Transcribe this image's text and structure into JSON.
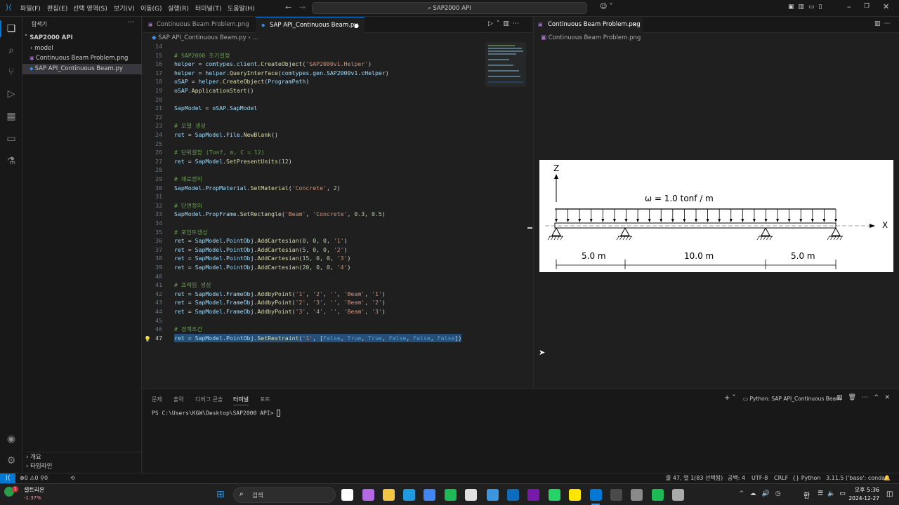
{
  "window": {
    "menu": [
      "파일(F)",
      "편집(E)",
      "선택 영역(S)",
      "보기(V)",
      "이동(G)",
      "실행(R)",
      "터미널(T)",
      "도움말(H)"
    ],
    "search": "SAP2000 API"
  },
  "sidebar": {
    "title": "탐색기",
    "root": "SAP2000 API",
    "items": [
      "model",
      "Continuous Beam Problem.png",
      "SAP API_Continuous Beam.py"
    ],
    "bottom": [
      "개요",
      "타임라인"
    ]
  },
  "editor": {
    "tabs": [
      "Continuous Beam Problem.png",
      "SAP API_Continuous Beam.py"
    ],
    "breadcrumb": [
      "SAP API_Continuous Beam.py",
      "..."
    ],
    "lines": [
      {
        "n": "14",
        "segs": []
      },
      {
        "n": "15",
        "segs": [
          [
            "cm",
            "# SAP2000 초기설정"
          ]
        ]
      },
      {
        "n": "16",
        "segs": [
          [
            "var",
            "helper"
          ],
          [
            "op",
            " = "
          ],
          [
            "var",
            "comtypes"
          ],
          [
            "op",
            "."
          ],
          [
            "var",
            "client"
          ],
          [
            "op",
            "."
          ],
          [
            "fn",
            "CreateObject"
          ],
          [
            "op",
            "("
          ],
          [
            "str",
            "'SAP2000v1.Helper'"
          ],
          [
            "op",
            ")"
          ]
        ]
      },
      {
        "n": "17",
        "segs": [
          [
            "var",
            "helper"
          ],
          [
            "op",
            " = "
          ],
          [
            "var",
            "helper"
          ],
          [
            "op",
            "."
          ],
          [
            "fn",
            "QueryInterface"
          ],
          [
            "op",
            "("
          ],
          [
            "var",
            "comtypes"
          ],
          [
            "op",
            "."
          ],
          [
            "var",
            "gen"
          ],
          [
            "op",
            "."
          ],
          [
            "var",
            "SAP2000v1"
          ],
          [
            "op",
            "."
          ],
          [
            "var",
            "cHelper"
          ],
          [
            "op",
            ")"
          ]
        ]
      },
      {
        "n": "18",
        "segs": [
          [
            "var",
            "oSAP"
          ],
          [
            "op",
            " = "
          ],
          [
            "var",
            "helper"
          ],
          [
            "op",
            "."
          ],
          [
            "fn",
            "CreateObject"
          ],
          [
            "op",
            "("
          ],
          [
            "var",
            "ProgramPath"
          ],
          [
            "op",
            ")"
          ]
        ]
      },
      {
        "n": "19",
        "segs": [
          [
            "var",
            "oSAP"
          ],
          [
            "op",
            "."
          ],
          [
            "fn",
            "ApplicationStart"
          ],
          [
            "op",
            "()"
          ]
        ]
      },
      {
        "n": "20",
        "segs": []
      },
      {
        "n": "21",
        "segs": [
          [
            "var",
            "SapModel"
          ],
          [
            "op",
            " = "
          ],
          [
            "var",
            "oSAP"
          ],
          [
            "op",
            "."
          ],
          [
            "var",
            "SapModel"
          ]
        ]
      },
      {
        "n": "22",
        "segs": []
      },
      {
        "n": "23",
        "segs": [
          [
            "cm",
            "# 모델 생성"
          ]
        ]
      },
      {
        "n": "24",
        "segs": [
          [
            "var",
            "ret"
          ],
          [
            "op",
            " = "
          ],
          [
            "var",
            "SapModel"
          ],
          [
            "op",
            "."
          ],
          [
            "var",
            "File"
          ],
          [
            "op",
            "."
          ],
          [
            "fn",
            "NewBlank"
          ],
          [
            "op",
            "()"
          ]
        ]
      },
      {
        "n": "25",
        "segs": []
      },
      {
        "n": "26",
        "segs": [
          [
            "cm",
            "# 단위설정 (Tonf, m, C = 12)"
          ]
        ]
      },
      {
        "n": "27",
        "segs": [
          [
            "var",
            "ret"
          ],
          [
            "op",
            " = "
          ],
          [
            "var",
            "SapModel"
          ],
          [
            "op",
            "."
          ],
          [
            "fn",
            "SetPresentUnits"
          ],
          [
            "op",
            "("
          ],
          [
            "num",
            "12"
          ],
          [
            "op",
            ")"
          ]
        ]
      },
      {
        "n": "28",
        "segs": []
      },
      {
        "n": "29",
        "segs": [
          [
            "cm",
            "# 재료정의"
          ]
        ]
      },
      {
        "n": "30",
        "segs": [
          [
            "var",
            "SapModel"
          ],
          [
            "op",
            "."
          ],
          [
            "var",
            "PropMaterial"
          ],
          [
            "op",
            "."
          ],
          [
            "fn",
            "SetMaterial"
          ],
          [
            "op",
            "("
          ],
          [
            "str",
            "'Concrete'"
          ],
          [
            "op",
            ", "
          ],
          [
            "num",
            "2"
          ],
          [
            "op",
            ")"
          ]
        ]
      },
      {
        "n": "31",
        "segs": []
      },
      {
        "n": "32",
        "segs": [
          [
            "cm",
            "# 단면정의"
          ]
        ]
      },
      {
        "n": "33",
        "segs": [
          [
            "var",
            "SapModel"
          ],
          [
            "op",
            "."
          ],
          [
            "var",
            "PropFrame"
          ],
          [
            "op",
            "."
          ],
          [
            "fn",
            "SetRectangle"
          ],
          [
            "op",
            "("
          ],
          [
            "str",
            "'Beam'"
          ],
          [
            "op",
            ", "
          ],
          [
            "str",
            "'Concrete'"
          ],
          [
            "op",
            ", "
          ],
          [
            "num",
            "0.3"
          ],
          [
            "op",
            ", "
          ],
          [
            "num",
            "0.5"
          ],
          [
            "op",
            ")"
          ]
        ]
      },
      {
        "n": "34",
        "segs": []
      },
      {
        "n": "35",
        "segs": [
          [
            "cm",
            "# 포인트생성"
          ]
        ]
      },
      {
        "n": "36",
        "segs": [
          [
            "var",
            "ret"
          ],
          [
            "op",
            " = "
          ],
          [
            "var",
            "SapModel"
          ],
          [
            "op",
            "."
          ],
          [
            "var",
            "PointObj"
          ],
          [
            "op",
            "."
          ],
          [
            "fn",
            "AddCartesian"
          ],
          [
            "op",
            "("
          ],
          [
            "num",
            "0"
          ],
          [
            "op",
            ", "
          ],
          [
            "num",
            "0"
          ],
          [
            "op",
            ", "
          ],
          [
            "num",
            "0"
          ],
          [
            "op",
            ", "
          ],
          [
            "str",
            "'1'"
          ],
          [
            "op",
            ")"
          ]
        ]
      },
      {
        "n": "37",
        "segs": [
          [
            "var",
            "ret"
          ],
          [
            "op",
            " = "
          ],
          [
            "var",
            "SapModel"
          ],
          [
            "op",
            "."
          ],
          [
            "var",
            "PointObj"
          ],
          [
            "op",
            "."
          ],
          [
            "fn",
            "AddCartesian"
          ],
          [
            "op",
            "("
          ],
          [
            "num",
            "5"
          ],
          [
            "op",
            ", "
          ],
          [
            "num",
            "0"
          ],
          [
            "op",
            ", "
          ],
          [
            "num",
            "0"
          ],
          [
            "op",
            ", "
          ],
          [
            "str",
            "'2'"
          ],
          [
            "op",
            ")"
          ]
        ]
      },
      {
        "n": "38",
        "segs": [
          [
            "var",
            "ret"
          ],
          [
            "op",
            " = "
          ],
          [
            "var",
            "SapModel"
          ],
          [
            "op",
            "."
          ],
          [
            "var",
            "PointObj"
          ],
          [
            "op",
            "."
          ],
          [
            "fn",
            "AddCartesian"
          ],
          [
            "op",
            "("
          ],
          [
            "num",
            "15"
          ],
          [
            "op",
            ", "
          ],
          [
            "num",
            "0"
          ],
          [
            "op",
            ", "
          ],
          [
            "num",
            "0"
          ],
          [
            "op",
            ", "
          ],
          [
            "str",
            "'3'"
          ],
          [
            "op",
            ")"
          ]
        ]
      },
      {
        "n": "39",
        "segs": [
          [
            "var",
            "ret"
          ],
          [
            "op",
            " = "
          ],
          [
            "var",
            "SapModel"
          ],
          [
            "op",
            "."
          ],
          [
            "var",
            "PointObj"
          ],
          [
            "op",
            "."
          ],
          [
            "fn",
            "AddCartesian"
          ],
          [
            "op",
            "("
          ],
          [
            "num",
            "20"
          ],
          [
            "op",
            ", "
          ],
          [
            "num",
            "0"
          ],
          [
            "op",
            ", "
          ],
          [
            "num",
            "0"
          ],
          [
            "op",
            ", "
          ],
          [
            "str",
            "'4'"
          ],
          [
            "op",
            ")"
          ]
        ]
      },
      {
        "n": "40",
        "segs": []
      },
      {
        "n": "41",
        "segs": [
          [
            "cm",
            "# 프레임 생성"
          ]
        ]
      },
      {
        "n": "42",
        "segs": [
          [
            "var",
            "ret"
          ],
          [
            "op",
            " = "
          ],
          [
            "var",
            "SapModel"
          ],
          [
            "op",
            "."
          ],
          [
            "var",
            "FrameObj"
          ],
          [
            "op",
            "."
          ],
          [
            "fn",
            "AddbyPoint"
          ],
          [
            "op",
            "("
          ],
          [
            "str",
            "'1'"
          ],
          [
            "op",
            ", "
          ],
          [
            "str",
            "'2'"
          ],
          [
            "op",
            ", "
          ],
          [
            "str",
            "''"
          ],
          [
            "op",
            ", "
          ],
          [
            "str",
            "'Beam'"
          ],
          [
            "op",
            ", "
          ],
          [
            "str",
            "'1'"
          ],
          [
            "op",
            ")"
          ]
        ]
      },
      {
        "n": "43",
        "segs": [
          [
            "var",
            "ret"
          ],
          [
            "op",
            " = "
          ],
          [
            "var",
            "SapModel"
          ],
          [
            "op",
            "."
          ],
          [
            "var",
            "FrameObj"
          ],
          [
            "op",
            "."
          ],
          [
            "fn",
            "AddbyPoint"
          ],
          [
            "op",
            "("
          ],
          [
            "str",
            "'2'"
          ],
          [
            "op",
            ", "
          ],
          [
            "str",
            "'3'"
          ],
          [
            "op",
            ", "
          ],
          [
            "str",
            "''"
          ],
          [
            "op",
            ", "
          ],
          [
            "str",
            "'Beam'"
          ],
          [
            "op",
            ", "
          ],
          [
            "str",
            "'2'"
          ],
          [
            "op",
            ")"
          ]
        ]
      },
      {
        "n": "44",
        "segs": [
          [
            "var",
            "ret"
          ],
          [
            "op",
            " = "
          ],
          [
            "var",
            "SapModel"
          ],
          [
            "op",
            "."
          ],
          [
            "var",
            "FrameObj"
          ],
          [
            "op",
            "."
          ],
          [
            "fn",
            "AddbyPoint"
          ],
          [
            "op",
            "("
          ],
          [
            "str",
            "'3'"
          ],
          [
            "op",
            ", "
          ],
          [
            "str",
            "'4'"
          ],
          [
            "op",
            ", "
          ],
          [
            "str",
            "''"
          ],
          [
            "op",
            ", "
          ],
          [
            "str",
            "'Beam'"
          ],
          [
            "op",
            ", "
          ],
          [
            "str",
            "'3'"
          ],
          [
            "op",
            ")"
          ]
        ]
      },
      {
        "n": "45",
        "segs": []
      },
      {
        "n": "46",
        "segs": [
          [
            "cm",
            "# 경계조건"
          ]
        ]
      },
      {
        "n": "47",
        "segs": [
          [
            "var",
            "ret"
          ],
          [
            "op",
            " = "
          ],
          [
            "var",
            "SapModel"
          ],
          [
            "op",
            "."
          ],
          [
            "var",
            "PointObj"
          ],
          [
            "op",
            "."
          ],
          [
            "fn",
            "SetRestraint"
          ],
          [
            "op",
            "("
          ],
          [
            "str",
            "'1'"
          ],
          [
            "op",
            ", ["
          ],
          [
            "kw",
            "False"
          ],
          [
            "op",
            ", "
          ],
          [
            "kw",
            "True"
          ],
          [
            "op",
            ", "
          ],
          [
            "kw",
            "True"
          ],
          [
            "op",
            ", "
          ],
          [
            "kw",
            "False"
          ],
          [
            "op",
            ", "
          ],
          [
            "kw",
            "False"
          ],
          [
            "op",
            ", "
          ],
          [
            "kw",
            "False"
          ],
          [
            "op",
            "])"
          ]
        ]
      }
    ]
  },
  "image_editor": {
    "tab": "Continuous Beam Problem.png",
    "breadcrumb": "Continuous Beam Problem.png",
    "figure": {
      "z_label": "Z",
      "x_label": "X",
      "load_label": "ω = 1.0 tonf / m",
      "spans": [
        "5.0 m",
        "10.0 m",
        "5.0 m"
      ]
    }
  },
  "panel": {
    "tabs": [
      "문제",
      "출력",
      "디버그 콘솔",
      "터미널",
      "포트"
    ],
    "active_tab": "터미널",
    "terminal_name": "Python: SAP API_Continuous Beam",
    "prompt": "PS C:\\Users\\KGW\\Desktop\\SAP2000 API> "
  },
  "statusbar": {
    "errors": "0",
    "warnings": "0",
    "ports": "0",
    "position": "줄 47, 열 1(83 선택됨)",
    "spaces": "공백: 4",
    "encoding": "UTF-8",
    "eol": "CRLF",
    "language": "Python",
    "interpreter": "3.11.5 ('base': conda)"
  },
  "taskbar": {
    "stock_name": "셀트리온",
    "stock_change": "-1.37%",
    "search": "검색",
    "time": "오후 5:36",
    "date": "2024-12-27",
    "lang": "한"
  },
  "colors": {
    "accent": "#0078d4",
    "selection": "#264f78",
    "comment": "#6a9955"
  }
}
